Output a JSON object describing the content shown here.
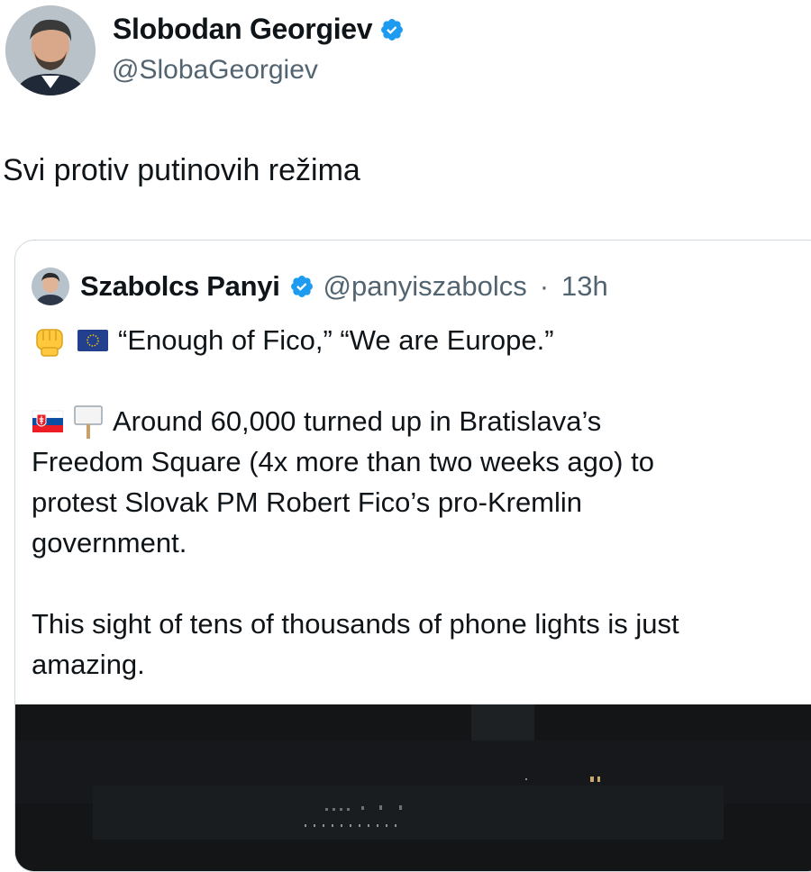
{
  "author": {
    "name": "Slobodan Georgiev",
    "handle": "@SlobaGeorgiev",
    "verified_color": "#1d9bf0"
  },
  "tweet": {
    "text": "Svi protiv putinovih režima"
  },
  "quote": {
    "name": "Szabolcs Panyi",
    "handle": "@panyiszabolcs",
    "separator": "·",
    "time": "13h",
    "line1": "“Enough of Fico,” “We are Europe.”",
    "line2": "Around 60,000 turned up in Bratislava’s",
    "line3": "Freedom Square (4x more than two weeks ago) to",
    "line4": "protest Slovak PM Robert Fico’s pro-Kremlin",
    "line5": "government.",
    "line6": "This sight of tens of thousands of phone lights is just",
    "line7": "amazing.",
    "emojis": [
      "raised-fist-icon",
      "eu-flag-icon",
      "slovakia-flag-icon",
      "placard-icon"
    ]
  },
  "colors": {
    "text": "#0f1419",
    "secondary": "#536471",
    "border": "#cfd9de",
    "verified": "#1d9bf0"
  }
}
